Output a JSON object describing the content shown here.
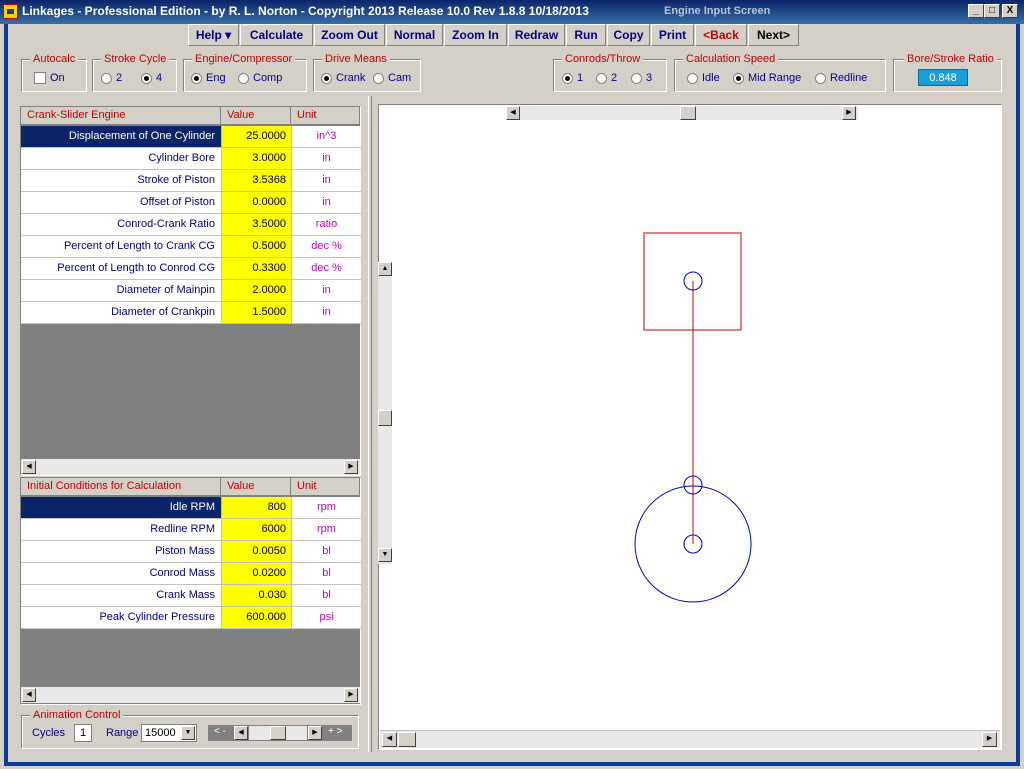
{
  "window": {
    "title": "Linkages - Professional Edition - by R. L. Norton - Copyright 2013   Release 10.0   Rev 1.8.8   10/18/2013",
    "screen_name": "Engine Input Screen",
    "minimize": "_",
    "maximize": "□",
    "close": "X"
  },
  "toolbar": {
    "help": "Help ▾",
    "calculate": "Calculate",
    "zoom_out": "Zoom Out",
    "normal": "Normal",
    "zoom_in": "Zoom In",
    "redraw": "Redraw",
    "run": "Run",
    "copy": "Copy",
    "print": "Print",
    "back": "<Back",
    "next": "Next>",
    "back_color": "#c00000"
  },
  "options": {
    "autocalc": {
      "legend": "Autocalc",
      "label": "On",
      "checked": false
    },
    "stroke_cycle": {
      "legend": "Stroke Cycle",
      "opt1": "2",
      "opt2": "4",
      "selected": "4"
    },
    "engine_compressor": {
      "legend": "Engine/Compressor",
      "opt1": "Eng",
      "opt2": "Comp",
      "selected": "Eng"
    },
    "drive_means": {
      "legend": "Drive Means",
      "opt1": "Crank",
      "opt2": "Cam",
      "selected": "Crank"
    },
    "conrods_throw": {
      "legend": "Conrods/Throw",
      "opt1": "1",
      "opt2": "2",
      "opt3": "3",
      "selected": "1"
    },
    "calc_speed": {
      "legend": "Calculation Speed",
      "opt1": "Idle",
      "opt2": "Mid Range",
      "opt3": "Redline",
      "selected": "Mid Range"
    },
    "bore_stroke": {
      "legend": "Bore/Stroke Ratio",
      "value": "0.848"
    }
  },
  "engine_table": {
    "headers": [
      "Crank-Slider Engine",
      "Value",
      "Unit"
    ],
    "rows": [
      {
        "name": "Displacement of One Cylinder",
        "value": "25.0000",
        "unit": "in^3"
      },
      {
        "name": "Cylinder Bore",
        "value": "3.0000",
        "unit": "in"
      },
      {
        "name": "Stroke of Piston",
        "value": "3.5368",
        "unit": "in"
      },
      {
        "name": "Offset of Piston",
        "value": "0.0000",
        "unit": "in"
      },
      {
        "name": "Conrod-Crank Ratio",
        "value": "3.5000",
        "unit": "ratio"
      },
      {
        "name": "Percent of Length to Crank CG",
        "value": "0.5000",
        "unit": "dec %"
      },
      {
        "name": "Percent of Length to Conrod CG",
        "value": "0.3300",
        "unit": "dec %"
      },
      {
        "name": "Diameter of Mainpin",
        "value": "2.0000",
        "unit": "in"
      },
      {
        "name": "Diameter of Crankpin",
        "value": "1.5000",
        "unit": "in"
      }
    ]
  },
  "conditions_table": {
    "headers": [
      "Initial Conditions for Calculation",
      "Value",
      "Unit"
    ],
    "rows": [
      {
        "name": "Idle RPM",
        "value": "800",
        "unit": "rpm"
      },
      {
        "name": "Redline RPM",
        "value": "6000",
        "unit": "rpm"
      },
      {
        "name": "Piston Mass",
        "value": "0.0050",
        "unit": "bl"
      },
      {
        "name": "Conrod Mass",
        "value": "0.0200",
        "unit": "bl"
      },
      {
        "name": "Crank Mass",
        "value": "0.030",
        "unit": "bl"
      },
      {
        "name": "Peak Cylinder Pressure",
        "value": "600.000",
        "unit": "psi"
      }
    ]
  },
  "animation": {
    "legend": "Animation Control",
    "cycles_label": "Cycles",
    "cycles": "1",
    "range_label": "Range",
    "range": "15000",
    "slow": "< -",
    "fast": "+ >"
  },
  "colors": {
    "linkage": "#c00000",
    "circles": "#0000c0",
    "highlight_cell": "#ffff00",
    "selected_row": "#0a246a"
  }
}
